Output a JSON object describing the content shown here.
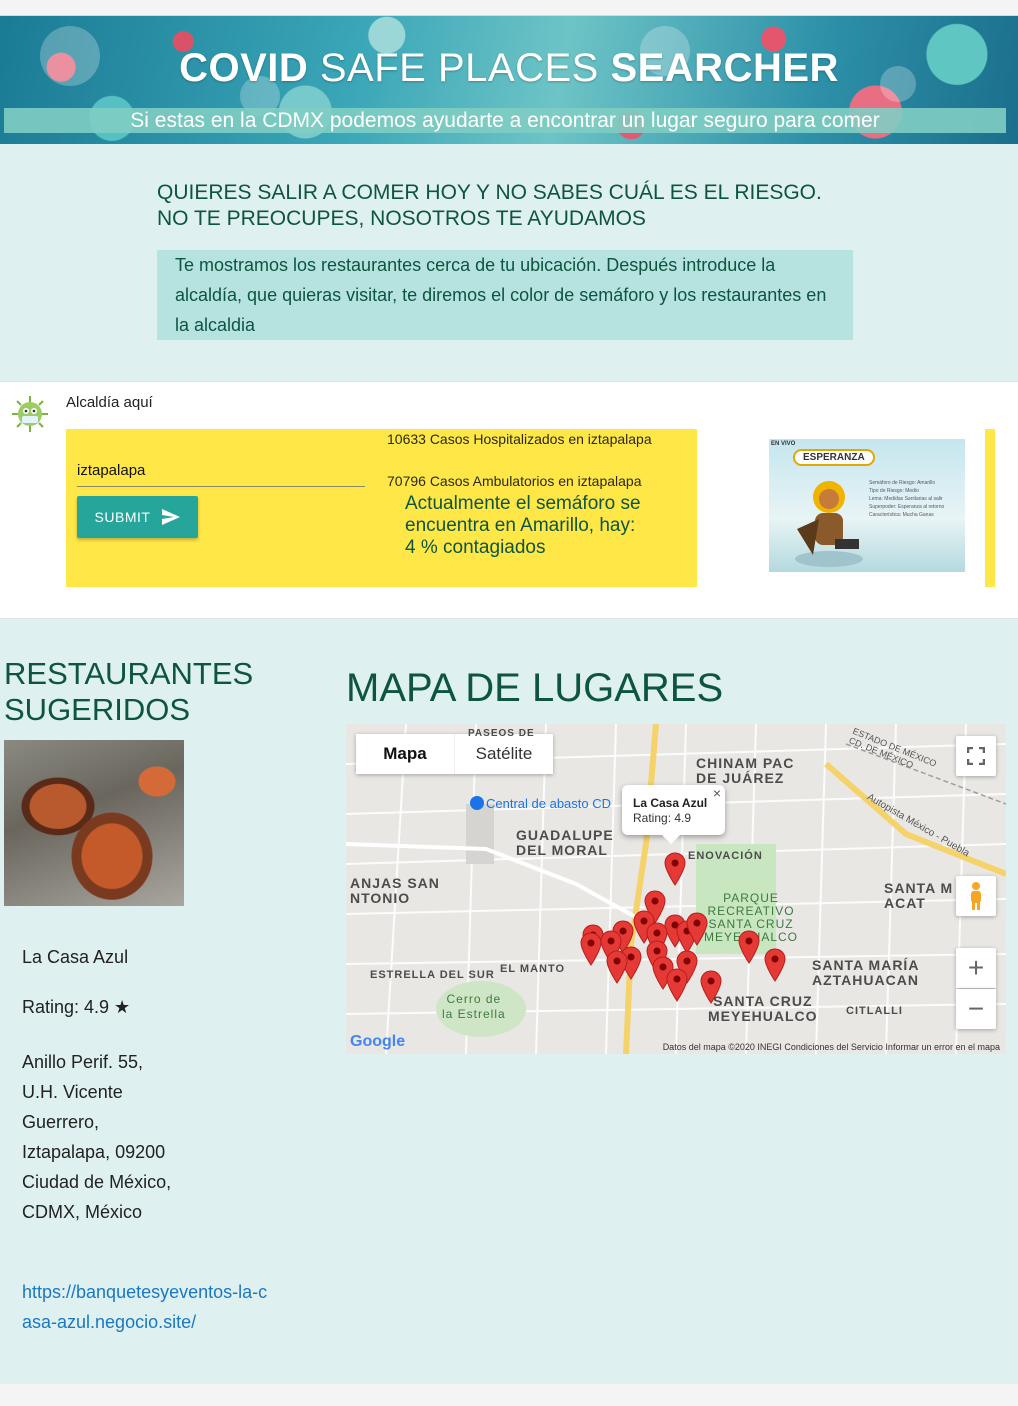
{
  "header": {
    "title_bold_1": "COVID",
    "title_regular": " SAFE PLACES ",
    "title_bold_2": "SEARCHER",
    "subtitle": "Si estas en la CDMX podemos ayudarte a encontrar un lugar seguro para comer"
  },
  "intro": {
    "heading_line1": "QUIERES SALIR A COMER HOY Y NO SABES CUÁL ES EL RIESGO.",
    "heading_line2": "NO TE PREOCUPES, NOSOTROS TE AYUDAMOS",
    "description": "Te mostramos los restaurantes cerca de tu ubicación. Después introduce la alcaldía, que quieras visitar, te diremos el color de semáforo y los restaurantes en la alcaldia"
  },
  "search": {
    "label": "Alcaldía aquí",
    "input_value": "iztapalapa",
    "submit_label": "SUBMIT",
    "hospitalized": "10633 Casos Hospitalizados en iztapalapa",
    "ambulatory": "70796 Casos Ambulatorios en iztapalapa",
    "semaforo_line1": "Actualmente el semáforo se encuentra en Amarillo, hay:",
    "semaforo_line2": "4 % contagiados",
    "promo_tag": "EN VIVO",
    "promo_title": "ESPERANZA",
    "promo_lines": [
      "Semáforo de Riesgo: Amarillo",
      "Tipo de Riesgo: Medio",
      "Lema: Medidas Sanitarias al salir",
      "Superpoder: Esperanza al retorno",
      "Característica: Mucha Ganas"
    ]
  },
  "restaurants": {
    "heading_line1": "RESTAURANTES",
    "heading_line2": "SUGERIDOS",
    "name": "La Casa Azul",
    "rating": "Rating: 4.9 ★",
    "address": "Anillo Perif. 55, U.H. Vicente Guerrero, Iztapalapa, 09200 Ciudad de México, CDMX, México",
    "link": "https://banquetesyeventos-la-casa-azul.negocio.site/"
  },
  "map": {
    "heading": "MAPA DE LUGARES",
    "tab_map": "Mapa",
    "tab_satellite": "Satélite",
    "popup_name": "La Casa Azul",
    "popup_rating": "Rating: 4.9",
    "place_labels": {
      "chinam": "CHINAM PAC\nDE JUÁREZ",
      "guadalupe": "GUADALUPE\nDEL MORAL",
      "sanjuan": "ANJAS SAN\nNTONIO",
      "parque": "PARQUE\nRECREATIVO\nSANTA CRUZ\nMEYEHUALCO",
      "santa_m": "SANTA M\nACAT",
      "estrella": "ESTRELLA DEL SUR",
      "manto": "EL MANTO",
      "cerro": "Cerro de\nla Estrella",
      "santa_maria": "SANTA MARÍA\nAZTAHUACAN",
      "santa_cruz": "SANTA CRUZ\nMEYEHUALCO",
      "citlalli": "CITLALLI",
      "renovacion": "ENOVACIÓN",
      "central": "Central de abasto CD",
      "edomex": "ESTADO DE MÉXICO\nCD. DE MÉXICO",
      "autopista": "Autopista México - Puebla",
      "pasos": "PASEOS DE"
    },
    "footer": "Datos del mapa ©2020 INEGI    Condiciones del Servicio    Informar un error en el mapa",
    "google": "Google"
  },
  "icons": {
    "virus": "virus-icon",
    "send": "send-icon",
    "fullscreen": "fullscreen-icon",
    "pegman": "pegman-icon",
    "zoom_in": "zoom-in-icon",
    "zoom_out": "zoom-out-icon",
    "close": "close-icon"
  },
  "colors": {
    "accent": "#26a69a",
    "heading": "#0d5540",
    "yellow_panel": "#ffe747",
    "page_bg": "#dff0f0",
    "link": "#1a78c2",
    "pin": "#e53935"
  }
}
